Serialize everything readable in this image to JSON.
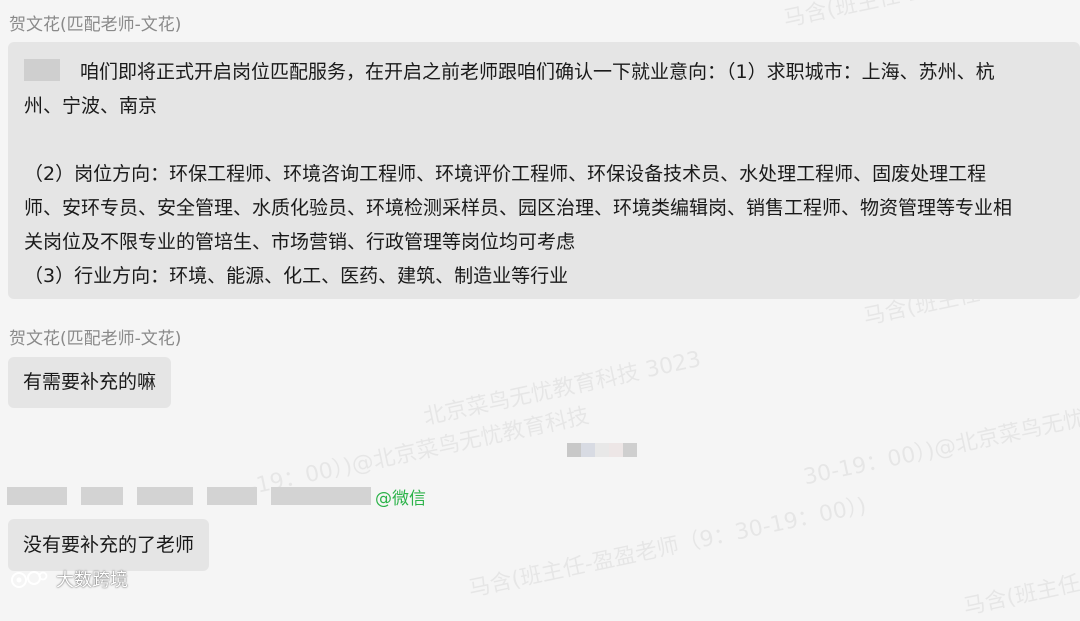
{
  "watermarks": [
    "马含(班主任-盈盈老师",
    "盈盈老师（9：30-19：00）)@北京菜鸟无忧教育科技 3023",
    "马含(班主任-",
    "-19：00）)@北京菜鸟无忧教育科技",
    "北京菜鸟无忧教育科技 3023",
    "马含(班主任-盈盈老师（9：30-19：00）)",
    "马含(班主任-",
    "马含(",
    "30-19：00）)@北京菜鸟无忧教育科技",
    "3023"
  ],
  "messages": [
    {
      "sender": "贺文花(匹配老师-文花)",
      "lines": [
        "咱们即将正式开启岗位匹配服务，在开启之前老师跟咱们确认一下就业意向：（1）求职城市：上海、苏州、杭",
        "州、宁波、南京",
        "",
        "（2）岗位方向：环保工程师、环境咨询工程师、环境评价工程师、环保设备技术员、水处理工程师、固废处理工程",
        "师、安环专员、安全管理、水质化验员、环境检测采样员、园区治理、环境类编辑岗、销售工程师、物资管理等专业相",
        "关岗位及不限专业的管培生、市场营销、行政管理等岗位均可考虑",
        "（3）行业方向：环境、能源、化工、医药、建筑、制造业等行业"
      ]
    },
    {
      "sender": "贺文花(匹配老师-文花)",
      "text": "有需要补充的嘛"
    },
    {
      "sender_suffix": "@微信",
      "text": "没有要补充的了老师"
    }
  ],
  "logo_text": "大数跨境"
}
